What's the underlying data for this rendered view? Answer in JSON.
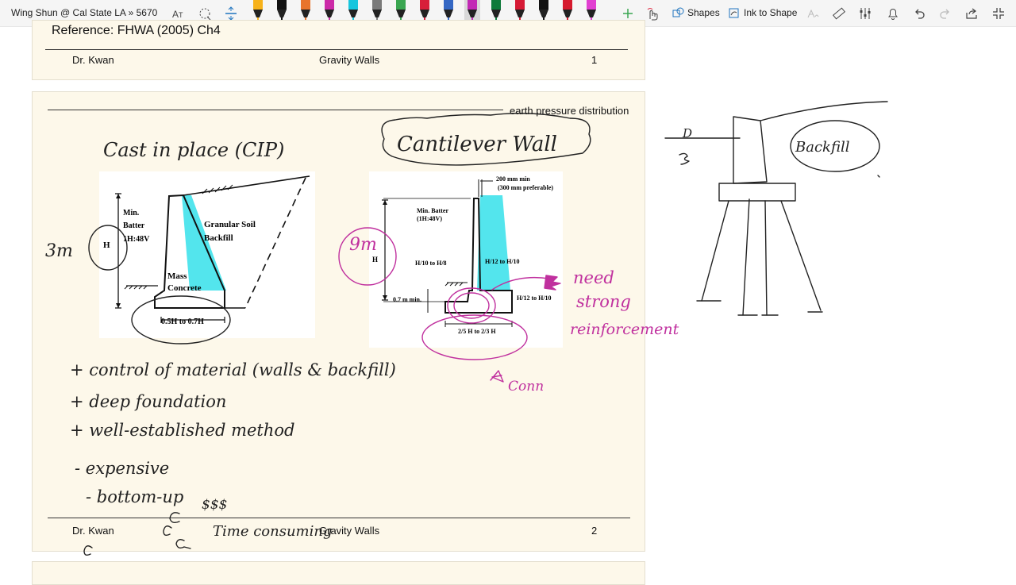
{
  "app": {
    "notebook_title": "Wing Shun @ Cal State LA » 5670",
    "shapes_label": "Shapes",
    "ink_to_shape_label": "Ink to Shape"
  },
  "pen_colors": [
    "#f7b21a",
    "#111111",
    "#e8742b",
    "#cc2aa9",
    "#16c6de",
    "#7a7a7a",
    "#3aa651",
    "#d81e3a",
    "#3467c4",
    "#c22ab5",
    "#0e7a3a",
    "#d61a35",
    "#111111",
    "#d61a2e",
    "#e13fd1"
  ],
  "page1": {
    "reference": "Reference: FHWA (2005) Ch4",
    "footer_left": "Dr. Kwan",
    "footer_center": "Gravity Walls",
    "footer_right": "1"
  },
  "page2": {
    "heading": "earth pressure distribution",
    "footer_left": "Dr. Kwan",
    "footer_center": "Gravity Walls",
    "footer_right": "2",
    "gravity_figure": {
      "label_min": "Min.",
      "label_batter": "Batter",
      "label_ratio": "1H:48V",
      "label_h": "H",
      "label_granular": "Granular Soil",
      "label_backfill": "Backfill",
      "label_mass": "Mass",
      "label_concrete": "Concrete",
      "label_base": "0.5H to 0.7H"
    },
    "cantilever_figure": {
      "label_stem_min": "200 mm min",
      "label_stem_pref": "(300 mm preferable)",
      "label_min_batter": "Min. Batter",
      "label_ratio": "(1H:48V)",
      "label_h": "H",
      "label_toe": "H/10 to H/8",
      "label_stem": "H/12 to H/10",
      "label_min_depth": "0.7 m min.",
      "label_base_thk": "H/12 to H/10",
      "label_base": "2/5 H to 2/3 H"
    }
  },
  "ink_notes": {
    "cip": "Cast in place (CIP)",
    "cantilever": "Cantilever Wall",
    "three_m": "3m",
    "nine_m": "9m",
    "need": "need",
    "strong": "strong",
    "reinforcement": "reinforcement",
    "conn": "Conn",
    "pro1": "+ control of material (walls & backfill)",
    "pro2": "+ deep foundation",
    "pro3": "+ well-established method",
    "con1": "- expensive",
    "con2": "- bottom-up",
    "dollars": "$$$",
    "time": "Time consuming",
    "backfill": "Backfill",
    "d_label": "D"
  }
}
